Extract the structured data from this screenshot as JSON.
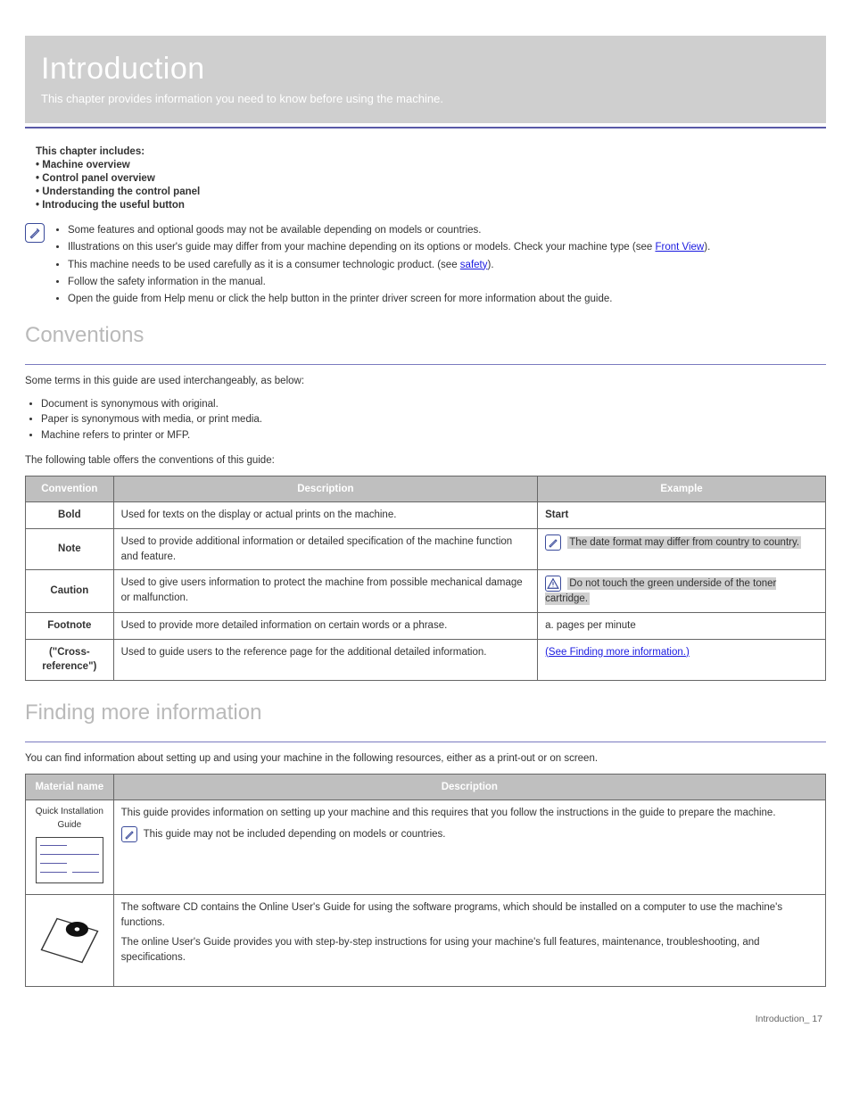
{
  "banner": {
    "title": "Introduction",
    "subtitle": "This chapter provides information you need to know before using the machine."
  },
  "intro_links": {
    "heading": "This chapter includes:",
    "items": [
      "Machine overview",
      "Control panel overview",
      "Understanding the control panel",
      "Introducing the useful button"
    ]
  },
  "notes": {
    "items": [
      {
        "text": "Some features and optional goods may not be available depending on models or countries."
      },
      {
        "text_prefix": "Illustrations on this user's guide may differ from your machine depending on its options or models. Check your machine type (see ",
        "link_text": "Front View",
        "text_suffix": ")."
      },
      {
        "text_prefix": "This machine needs to be used carefully as it is a consumer technologic product. (see ",
        "link_text": "safety",
        "text_suffix": ")."
      },
      {
        "text": "Follow the safety information in the manual."
      },
      {
        "text": "Open the guide from Help menu or click the help button in the printer driver screen for more information about the guide."
      }
    ]
  },
  "conventions": {
    "heading": "Conventions",
    "intro": "Some terms in this guide are used interchangeably, as below:",
    "bullets": [
      "Document is synonymous with original.",
      "Paper is synonymous with media, or print media.",
      "Machine refers to printer or MFP."
    ],
    "table_sub": "The following table offers the conventions of this guide:",
    "table": {
      "headers": [
        "Convention",
        "Description",
        "Example"
      ],
      "rows": [
        {
          "conv": "Bold",
          "desc": "Used for texts on the display or actual prints on the machine.",
          "ex": "Start"
        },
        {
          "conv": "Note",
          "desc": "Used to provide additional information or detailed specification of the machine function and feature.",
          "ex_prefix": "",
          "ex_highlight": "The date format may differ from country to country.",
          "icon": "note"
        },
        {
          "conv": "Caution",
          "desc": "Used to give users information to protect the machine from possible mechanical damage or malfunction.",
          "ex_highlight": "Do not touch the green underside of the toner cartridge.",
          "icon": "caution"
        },
        {
          "conv": "Footnote",
          "desc": "Used to provide more detailed information on certain words or a phrase.",
          "ex": "a. pages per minute"
        },
        {
          "conv_html": "(\"Cross-reference\")",
          "desc": "Used to guide users to the reference page for the additional detailed information.",
          "ex_link": "(See Finding more information.)"
        }
      ]
    }
  },
  "finding": {
    "heading": "Finding more information",
    "intro": "You can find information about setting up and using your machine in the following resources, either as a print-out or on screen.",
    "table": {
      "headers": [
        "Material name",
        "Description"
      ],
      "rows": [
        {
          "name": "Quick Installation Guide",
          "desc_line1": "This guide provides information on setting up your machine and this requires that you follow the instructions in the guide to prepare the machine.",
          "desc_line2": "This guide may not be included depending on models or countries.",
          "icon": "quickguide"
        },
        {
          "name": "",
          "desc_line1": "The software CD contains the Online User's Guide for using the software programs, which should be installed on a computer to use the machine's functions.",
          "desc_line2": "The online User's Guide provides you with step-by-step instructions for using your machine's full features, maintenance, troubleshooting, and specifications.",
          "icon": "cd"
        }
      ]
    }
  },
  "foot": "Introduction_ 17"
}
